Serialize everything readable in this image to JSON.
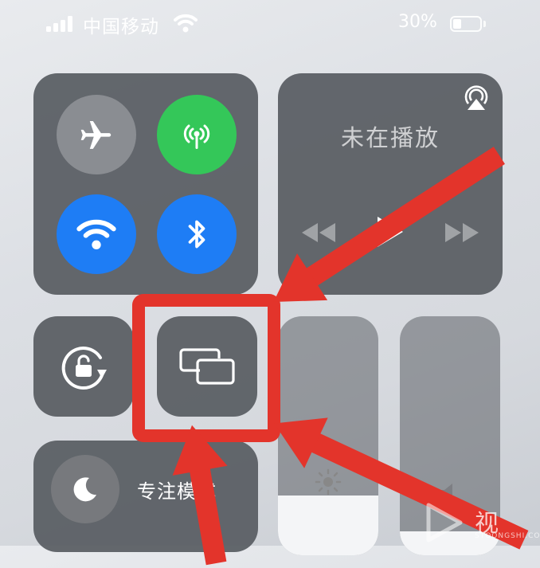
{
  "status_bar": {
    "carrier": "中国移动",
    "battery_percent": "30%",
    "battery_level": 0.3
  },
  "control_center": {
    "now_playing": {
      "title": "未在播放"
    },
    "focus": {
      "label": "专注模式"
    }
  },
  "colors": {
    "cellular_active": "#34c759",
    "wifi_active": "#1e7df5",
    "bluetooth_active": "#1e7df5",
    "annotation_red": "#e3342b"
  },
  "watermark": {
    "text": "视",
    "small": "STOONGSHI.COM"
  }
}
